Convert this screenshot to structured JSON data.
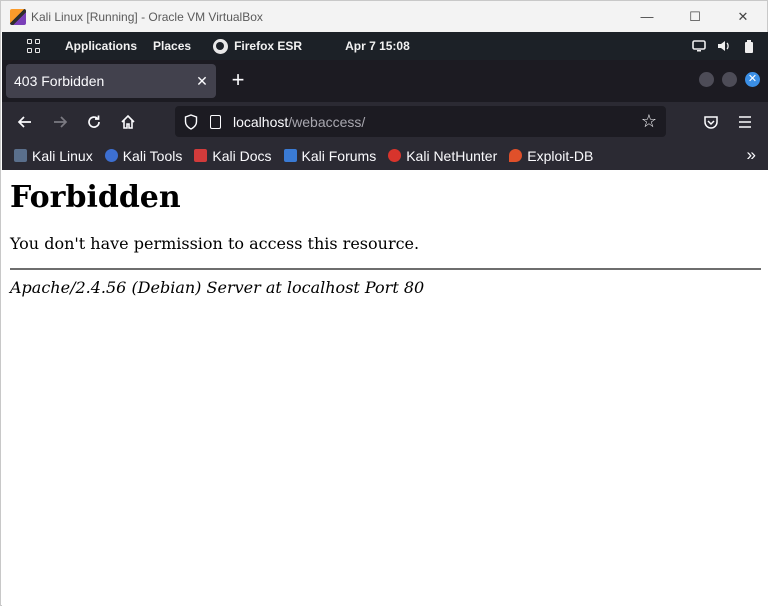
{
  "host": {
    "title": "Kali Linux [Running] - Oracle VM VirtualBox",
    "controls": {
      "minimize": "—",
      "maximize": "☐",
      "close": "✕"
    }
  },
  "panel": {
    "applications": "Applications",
    "places": "Places",
    "active_app": "Firefox ESR",
    "clock": "Apr 7  15:08"
  },
  "browser": {
    "tab_title": "403 Forbidden",
    "tab_close": "✕",
    "new_tab": "+",
    "url_host": "localhost",
    "url_path": "/webaccess/",
    "bookmarks": [
      {
        "label": "Kali Linux",
        "color": "#5a6f8c"
      },
      {
        "label": "Kali Tools",
        "color": "#3d6fd1"
      },
      {
        "label": "Kali Docs",
        "color": "#d23b3b"
      },
      {
        "label": "Kali Forums",
        "color": "#3a7bd5"
      },
      {
        "label": "Kali NetHunter",
        "color": "#d8342c"
      },
      {
        "label": "Exploit-DB",
        "color": "#e0502a"
      }
    ],
    "overflow": "»"
  },
  "page": {
    "heading": "Forbidden",
    "message": "You don't have permission to access this resource.",
    "server_signature": "Apache/2.4.56 (Debian) Server at localhost Port 80"
  },
  "colors": {
    "panel_bg": "#1c2127",
    "tabstrip_bg": "#1c1b22",
    "toolbar_bg": "#2b2a33",
    "accent_blue": "#3b8fe6"
  }
}
